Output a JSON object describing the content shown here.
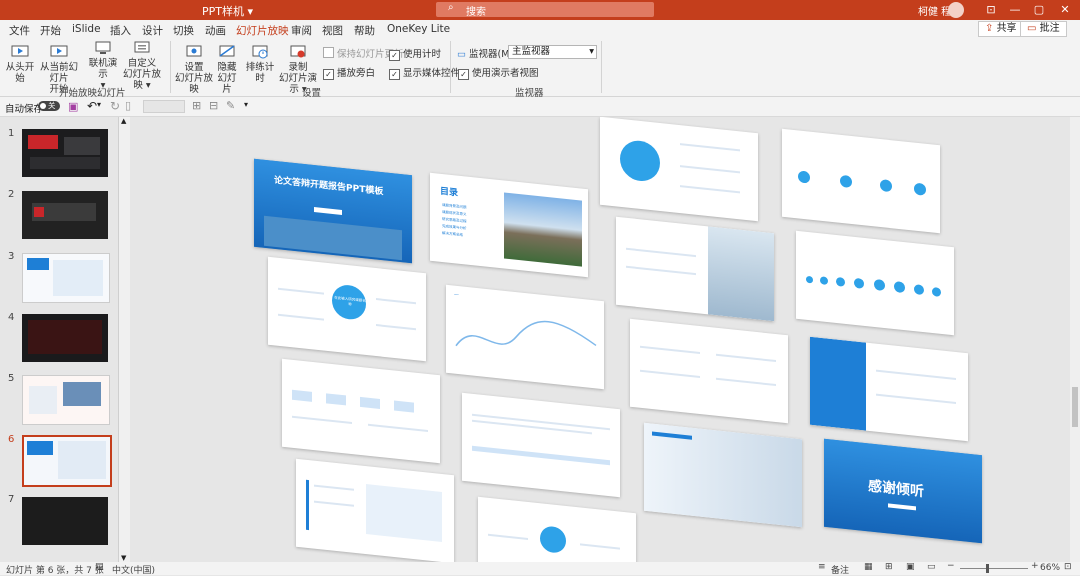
{
  "titlebar": {
    "app_name": "PPT样机 ▾",
    "search_placeholder": "搜索",
    "user_name": "柯健 程",
    "min": "—",
    "restore": "▢",
    "close": "✕",
    "ribbon_opts": "⊡"
  },
  "tabs": [
    "文件",
    "开始",
    "iSlide",
    "插入",
    "设计",
    "切换",
    "动画",
    "幻灯片放映",
    "审阅",
    "视图",
    "帮助",
    "OneKey Lite"
  ],
  "active_tab": "幻灯片放映",
  "share_label": "共享",
  "comment_label": "批注",
  "ribbon": {
    "from_start": "从头开始",
    "from_current_1": "从当前幻灯片",
    "from_current_2": "开始",
    "online_1": "联机演示",
    "online_2": "▾",
    "custom_1": "自定义",
    "custom_2": "幻灯片放映 ▾",
    "group_start": "开始放映幻灯片",
    "setup_1": "设置",
    "setup_2": "幻灯片放映",
    "hide_1": "隐藏",
    "hide_2": "幻灯片",
    "rehearse": "排练计时",
    "record_1": "录制",
    "record_2": "幻灯片演示 ▾",
    "keep_updated": "保持幻灯片更新",
    "use_timing": "使用计时",
    "play_narration": "播放旁白",
    "show_media": "显示媒体控件",
    "group_setup": "设置",
    "monitor_label": "监视器(M):",
    "monitor_value": "主监视器",
    "presenter_view": "使用演示者视图",
    "group_monitor": "监视器",
    "check": "✓"
  },
  "qat": {
    "autosave": "自动保存",
    "autosave_state": "关"
  },
  "slides_panel": [
    "1",
    "2",
    "3",
    "4",
    "5",
    "6",
    "7"
  ],
  "selected_slide": 6,
  "mock_slides": {
    "title_slide": "论文答辩开题报告PPT模板",
    "toc": "目录",
    "toc_items": [
      "课题背景及问题",
      "课题现状及意义",
      "研究思路及过程",
      "完成效果与分析",
      "解决方案总结"
    ],
    "thanks": "感谢倾听",
    "center_label": "在此输入研究课题名称"
  },
  "status": {
    "slide_info": "幻灯片 第 6 张，共 7 张",
    "language": "中文(中国)",
    "notes": "备注",
    "zoom": "66%"
  }
}
